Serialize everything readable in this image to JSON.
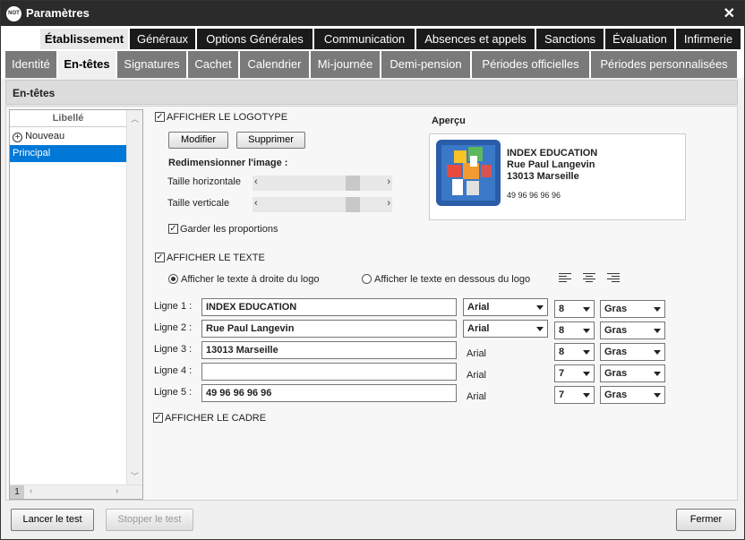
{
  "window": {
    "title": "Paramètres",
    "logo_text": "NOT"
  },
  "tabs_top": [
    "Établissement",
    "Généraux",
    "Options Générales",
    "Communication",
    "Absences et appels",
    "Sanctions",
    "Évaluation",
    "Infirmerie"
  ],
  "tabs_sub": [
    "Identité",
    "En-têtes",
    "Signatures",
    "Cachet",
    "Calendrier",
    "Mi-journée",
    "Demi-pension",
    "Périodes officielles",
    "Périodes personnalisées"
  ],
  "section_title": "En-têtes",
  "left_panel": {
    "header": "Libellé",
    "new_item": "Nouveau",
    "items": [
      "Principal"
    ],
    "page_number": "1"
  },
  "logo": {
    "show_label": "AFFICHER LE LOGOTYPE",
    "modify_button": "Modifier",
    "delete_button": "Supprimer",
    "resize_label": "Redimensionner l'image :",
    "horizontal_label": "Taille horizontale",
    "vertical_label": "Taille verticale",
    "keep_proportions_label": "Garder les proportions"
  },
  "text": {
    "show_label": "AFFICHER LE TEXTE",
    "option_right": "Afficher le texte à droite du logo",
    "option_below": "Afficher le texte en dessous du logo"
  },
  "lines": [
    {
      "label": "Ligne 1 :",
      "value": "INDEX EDUCATION",
      "font": "Arial",
      "size": "8",
      "style": "Gras"
    },
    {
      "label": "Ligne 2 :",
      "value": "Rue Paul Langevin",
      "font": "Arial",
      "size": "8",
      "style": "Gras"
    },
    {
      "label": "Ligne 3 :",
      "value": "13013 Marseille",
      "font": "Arial",
      "size": "8",
      "style": "Gras"
    },
    {
      "label": "Ligne 4 :",
      "value": "",
      "font": "Arial",
      "size": "7",
      "style": "Gras"
    },
    {
      "label": "Ligne 5 :",
      "value": "49 96 96 96 96",
      "font": "Arial",
      "size": "7",
      "style": "Gras"
    }
  ],
  "frame": {
    "show_label": "AFFICHER LE CADRE"
  },
  "preview": {
    "title": "Aperçu",
    "line1": "INDEX EDUCATION",
    "line2": "Rue Paul Langevin",
    "line3": "13013 Marseille",
    "line5": "49 96 96 96 96"
  },
  "footer": {
    "run_test": "Lancer le test",
    "stop_test": "Stopper le test",
    "close": "Fermer"
  }
}
